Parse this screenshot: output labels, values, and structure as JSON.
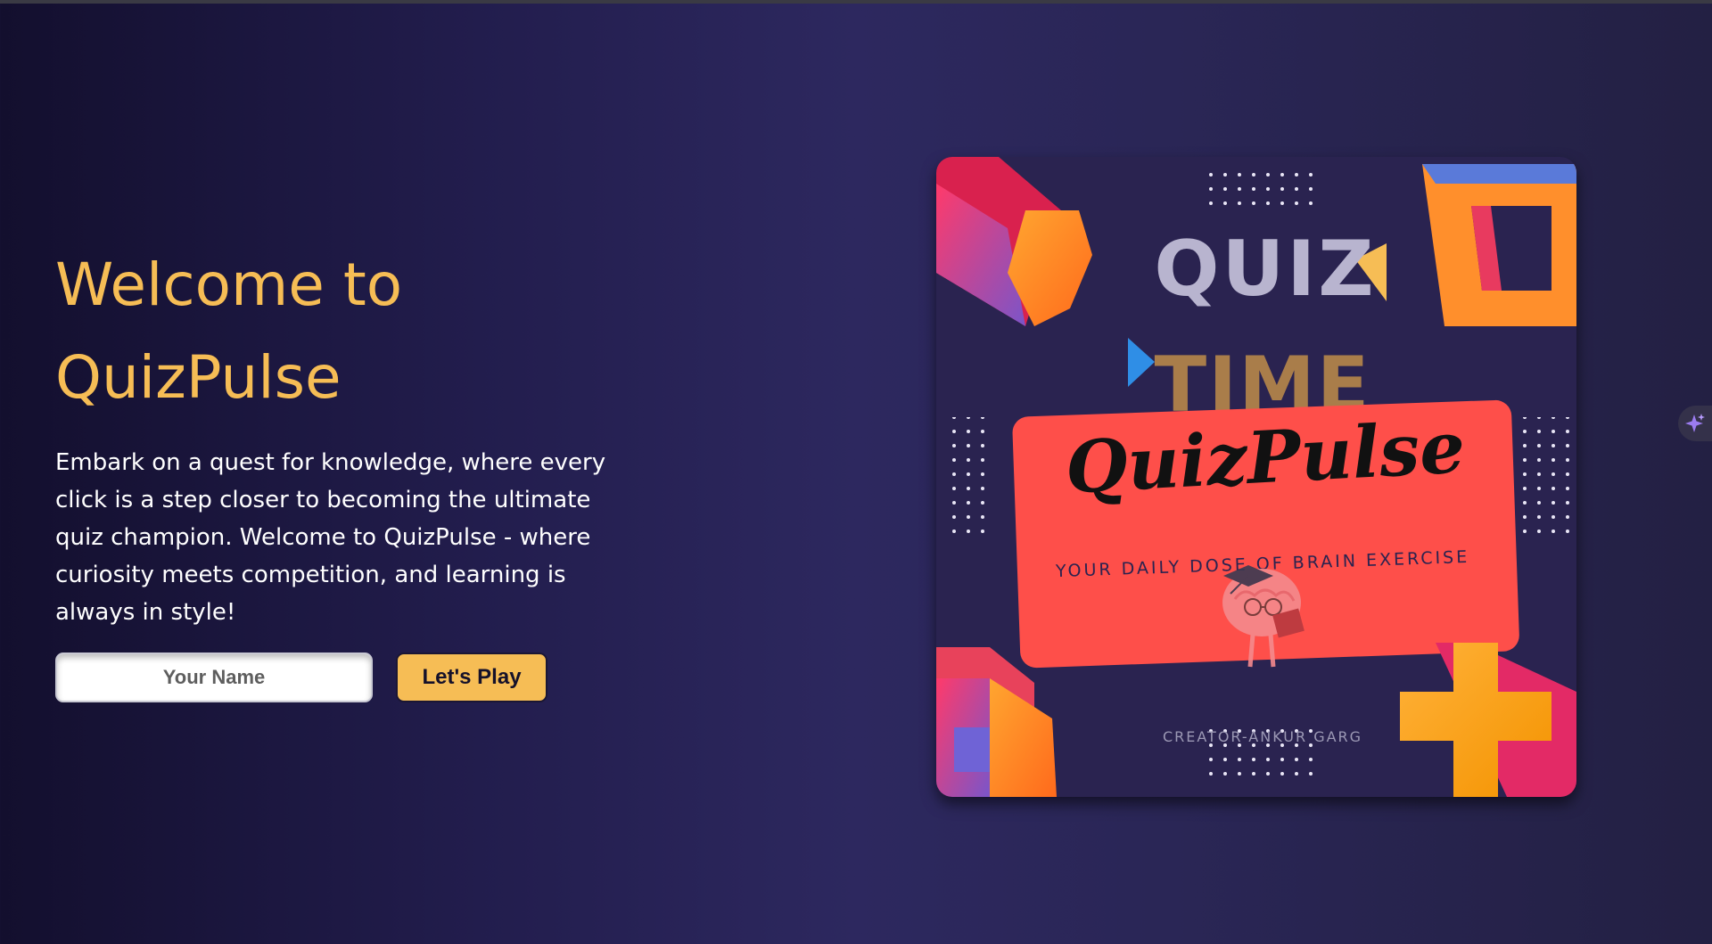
{
  "hero": {
    "title_line1": "Welcome to",
    "title_line2": "QuizPulse",
    "description": "Embark on a quest for knowledge, where every click is a step closer to becoming the ultimate quiz champion. Welcome to QuizPulse - where curiosity meets competition, and learning is always in style!"
  },
  "form": {
    "name_placeholder": "Your Name",
    "name_value": "",
    "play_label": "Let's Play"
  },
  "poster": {
    "quiz_word": "QUIZ",
    "time_word": "TIME",
    "brand": "QuizPulse",
    "tagline": "YOUR DAILY DOSE OF BRAIN EXERCISE",
    "creator": "CREATOR-ANKUR GARG"
  },
  "side_widget": {
    "icon": "sparkle-icon"
  },
  "colors": {
    "accent": "#f6bd55",
    "poster_background": "#2a2350",
    "card": "#fe4f4a"
  }
}
